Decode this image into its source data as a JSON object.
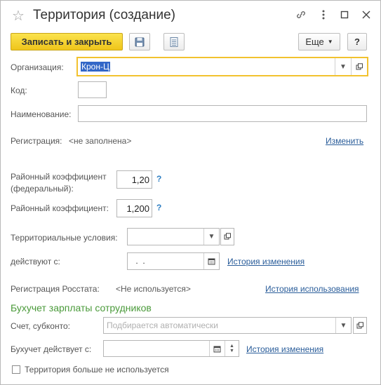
{
  "window": {
    "title": "Территория (создание)"
  },
  "toolbar": {
    "save_close_label": "Записать и закрыть",
    "more_label": "Еще",
    "help_label": "?"
  },
  "form": {
    "organization": {
      "label": "Организация:",
      "value": "Крон-Ц"
    },
    "code": {
      "label": "Код:",
      "value": ""
    },
    "name": {
      "label": "Наименование:",
      "value": ""
    },
    "registration": {
      "label": "Регистрация:",
      "value": "<не заполнена>",
      "change_link": "Изменить"
    },
    "coef_federal": {
      "label_line1": "Районный коэффициент",
      "label_line2": "(федеральный):",
      "value": "1,20",
      "help": "?"
    },
    "coef": {
      "label": "Районный коэффициент:",
      "value": "1,200",
      "help": "?"
    },
    "territorial_conditions": {
      "label": "Территориальные условия:",
      "value": ""
    },
    "valid_from": {
      "label": "действуют с:",
      "value": " .  .",
      "history_link": "История изменения"
    },
    "rosstat": {
      "label": "Регистрация Росстата:",
      "value": "<Не используется>",
      "history_link": "История использования"
    },
    "section_title": "Бухучет зарплаты сотрудников",
    "account": {
      "label": "Счет, субконто:",
      "placeholder": "Подбирается автоматически"
    },
    "accounting_from": {
      "label": "Бухучет действует с:",
      "value": "",
      "history_link": "История изменения"
    },
    "not_used": {
      "label": "Территория больше не используется",
      "checked": false
    }
  }
}
